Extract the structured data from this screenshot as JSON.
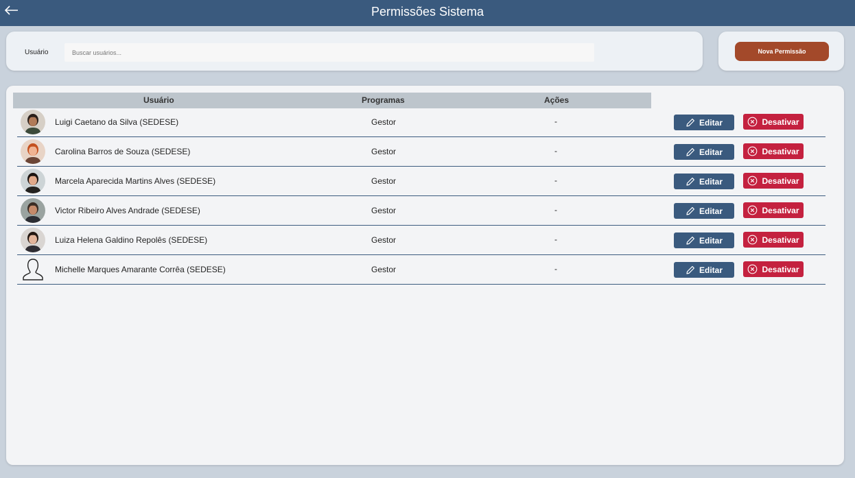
{
  "header": {
    "title": "Permissões Sistema",
    "back_icon": "arrow-left-icon",
    "background": "#3a5a7e"
  },
  "filter": {
    "label": "Usuário",
    "placeholder": "Buscar usuários..."
  },
  "toolbar": {
    "new_permission_label": "Nova Permissão",
    "new_permission_color": "#a3492a"
  },
  "table": {
    "columns": [
      "Usuário",
      "Programas",
      "Ações"
    ],
    "edit_label": "Editar",
    "edit_icon": "pencil-icon",
    "deactivate_label": "Desativar",
    "deactivate_icon": "x-circle-icon",
    "rows": [
      {
        "name": "Luigi Caetano da Silva (SEDESE)",
        "program": "Gestor",
        "actions": "-",
        "avatar": "photo"
      },
      {
        "name": "Carolina Barros de Souza (SEDESE)",
        "program": "Gestor",
        "actions": "-",
        "avatar": "photo"
      },
      {
        "name": "Marcela Aparecida Martins Alves (SEDESE)",
        "program": "Gestor",
        "actions": "-",
        "avatar": "photo"
      },
      {
        "name": "Victor Ribeiro Alves Andrade (SEDESE)",
        "program": "Gestor",
        "actions": "-",
        "avatar": "photo"
      },
      {
        "name": "Luiza Helena Galdino Repolês (SEDESE)",
        "program": "Gestor",
        "actions": "-",
        "avatar": "photo"
      },
      {
        "name": "Michelle Marques Amarante Corrêa (SEDESE)",
        "program": "Gestor",
        "actions": "-",
        "avatar": "placeholder-user-icon"
      }
    ]
  }
}
